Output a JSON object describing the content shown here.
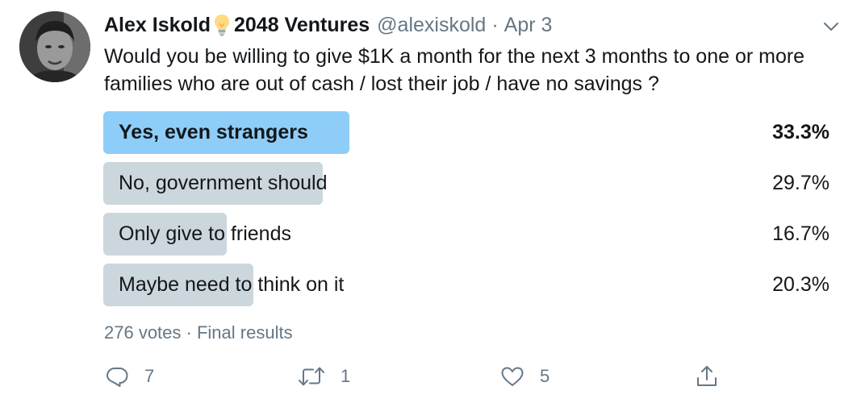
{
  "tweet": {
    "author_name": "Alex Iskold",
    "author_emoji_icon": "light-bulb-icon",
    "author_company": "2048 Ventures",
    "handle": "@alexiskold",
    "separator": "·",
    "date": "Apr 3",
    "text": "Would you be willing to give $1K a month for the next 3 months to one or more families who are out of cash / lost their job / have no savings ?"
  },
  "poll": {
    "options": [
      {
        "label": "Yes, even strangers",
        "percent": "33.3%",
        "fraction": 0.333,
        "winner": true
      },
      {
        "label": "No, government should",
        "percent": "29.7%",
        "fraction": 0.297,
        "winner": false
      },
      {
        "label": "Only give to friends",
        "percent": "16.7%",
        "fraction": 0.167,
        "winner": false
      },
      {
        "label": "Maybe need to think on it",
        "percent": "20.3%",
        "fraction": 0.203,
        "winner": false
      }
    ],
    "votes": "276 votes",
    "separator": "·",
    "status": "Final results"
  },
  "actions": {
    "replies": {
      "icon": "reply-icon",
      "count": "7"
    },
    "retweets": {
      "icon": "retweet-icon",
      "count": "1"
    },
    "likes": {
      "icon": "heart-icon",
      "count": "5"
    },
    "share": {
      "icon": "share-icon"
    }
  },
  "colors": {
    "winner_bar": "#8ecdf8",
    "other_bar": "#ccd6dd",
    "muted_text": "#657786",
    "primary_text": "#14171a"
  }
}
